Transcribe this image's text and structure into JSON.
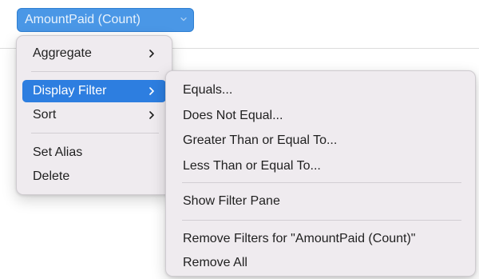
{
  "field": {
    "label": "AmountPaid (Count)",
    "icon": "chevron-down-icon"
  },
  "context_menu": {
    "items": [
      {
        "label": "Aggregate",
        "has_submenu": true
      },
      {
        "label": "Display Filter",
        "has_submenu": true,
        "highlighted": true
      },
      {
        "label": "Sort",
        "has_submenu": true
      },
      {
        "label": "Set Alias",
        "has_submenu": false
      },
      {
        "label": "Delete",
        "has_submenu": false
      }
    ]
  },
  "display_filter_submenu": {
    "items": [
      {
        "label": "Equals..."
      },
      {
        "label": "Does Not Equal..."
      },
      {
        "label": "Greater Than or Equal To..."
      },
      {
        "label": "Less Than or Equal To..."
      },
      {
        "label": "Show Filter Pane"
      },
      {
        "label": "Remove Filters for \"AmountPaid (Count)\""
      },
      {
        "label": "Remove All"
      }
    ]
  },
  "colors": {
    "highlight": "#2d7ee0",
    "pill": "#4a97e6",
    "menu_bg": "#efebef"
  }
}
